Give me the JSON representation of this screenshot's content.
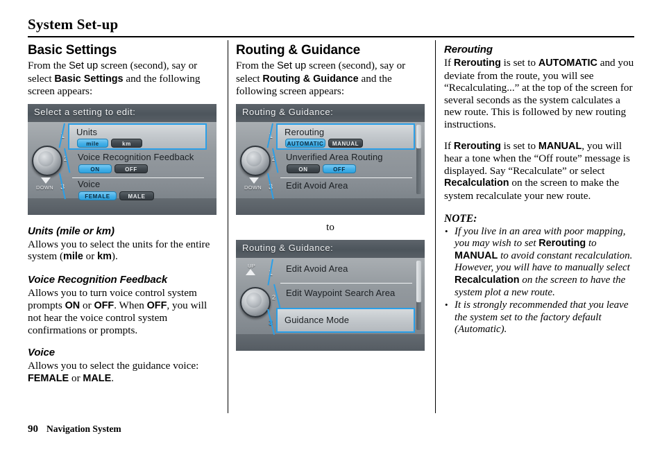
{
  "page": {
    "title": "System Set-up",
    "number": "90",
    "footer_text": "Navigation System"
  },
  "left_column": {
    "heading": "Basic Settings",
    "intro_a": "From the ",
    "intro_b": "Set up",
    "intro_c": " screen (second), say or select ",
    "intro_d": "Basic Settings",
    "intro_e": " and the following screen appears:",
    "screen": {
      "title": "Select a setting to edit:",
      "down_label": "DOWN",
      "rows": [
        {
          "num": "1",
          "label": "Units",
          "pills": [
            {
              "text": "mile",
              "state": "on"
            },
            {
              "text": "km",
              "state": "off"
            }
          ]
        },
        {
          "num": "2",
          "label": "Voice Recognition Feedback",
          "pills": [
            {
              "text": "ON",
              "state": "on"
            },
            {
              "text": "OFF",
              "state": "off"
            }
          ]
        },
        {
          "num": "3",
          "label": "Voice",
          "pills": [
            {
              "text": "FEMALE",
              "state": "on"
            },
            {
              "text": "MALE",
              "state": "off"
            }
          ]
        }
      ]
    },
    "sections": [
      {
        "heading": "Units (mile or km)",
        "text_a": "Allows you to select the units for the entire system (",
        "bold_1": "mile",
        "text_b": " or ",
        "bold_2": "km",
        "text_c": ")."
      },
      {
        "heading": "Voice Recognition Feedback",
        "text_a": "Allows you to turn voice control system prompts ",
        "bold_1": "ON",
        "text_b": " or ",
        "bold_2": "OFF",
        "text_c": ". When ",
        "bold_3": "OFF",
        "text_d": ", you will not hear the voice control system confirmations or prompts."
      },
      {
        "heading": "Voice",
        "text_a": "Allows you to select the guidance voice: ",
        "bold_1": "FEMALE",
        "text_b": " or ",
        "bold_2": "MALE",
        "text_c": "."
      }
    ]
  },
  "middle_column": {
    "heading": "Routing & Guidance",
    "intro_a": "From the ",
    "intro_b": "Set up",
    "intro_c": " screen (second), say or select ",
    "intro_d": "Routing & Guidance",
    "intro_e": " and the following screen appears:",
    "connector": "to",
    "screen_1": {
      "title": "Routing & Guidance:",
      "down_label": "DOWN",
      "rows": [
        {
          "num": "1",
          "label": "Rerouting",
          "pills": [
            {
              "text": "AUTOMATIC",
              "state": "on"
            },
            {
              "text": "MANUAL",
              "state": "off"
            }
          ]
        },
        {
          "num": "2",
          "label": "Unverified Area Routing",
          "pills": [
            {
              "text": "ON",
              "state": "off"
            },
            {
              "text": "OFF",
              "state": "on"
            }
          ]
        },
        {
          "num": "3",
          "label": "Edit Avoid Area",
          "pills": []
        }
      ]
    },
    "screen_2": {
      "title": "Routing & Guidance:",
      "up_label": "UP",
      "rows": [
        {
          "num": "1",
          "label": "Edit Avoid Area"
        },
        {
          "num": "2",
          "label": "Edit Waypoint Search Area"
        },
        {
          "num": "3",
          "label": "Guidance Mode"
        }
      ]
    }
  },
  "right_column": {
    "heading": "Rerouting",
    "para_1": {
      "a": "If ",
      "b_1": "Rerouting",
      "c": " is set to ",
      "b_2": "AUTOMATIC",
      "d": " and you deviate from the route, you will see “Recalculating...” at the top of the screen for several seconds as the system calculates a new route. This is followed by new routing instructions."
    },
    "para_2": {
      "a": "If ",
      "b_1": "Rerouting",
      "c": " is set to ",
      "b_2": "MANUAL",
      "d": ", you will hear a tone when the “Off route” message is displayed. Say “Recalculate” or select ",
      "b_3": "Recalculation",
      "e": " on the screen to make the system recalculate your new route."
    },
    "note_heading": "NOTE:",
    "notes": [
      {
        "a": "If you live in an area with poor mapping, you may wish to set ",
        "b_1": "Rerouting",
        "c": " to ",
        "b_2": "MANUAL",
        "d": " to avoid constant recalculation. However, you will have to manually select ",
        "b_3": "Recalculation",
        "e": " on the screen to have the system plot a new route."
      },
      {
        "a": "It is strongly recommended that you leave the system set to the factory default (Automatic)."
      }
    ]
  },
  "colors": {
    "accent_blue": "#2a9fe8",
    "screen_bg": "#8c9298",
    "titlebar": "#4d555c"
  }
}
